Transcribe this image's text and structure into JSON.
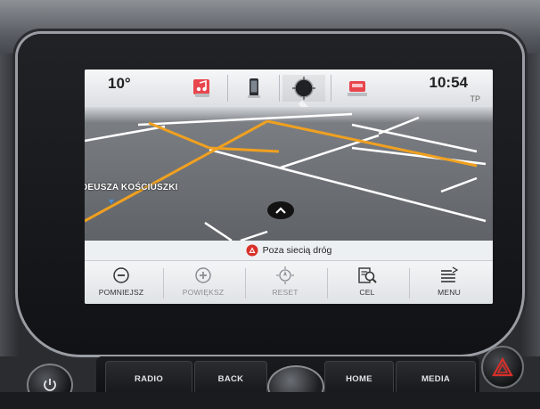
{
  "status": {
    "temperature": "10°",
    "time": "10:54",
    "tp_indicator": "TP"
  },
  "top_tabs": [
    {
      "name": "audio",
      "icon": "music-note-icon"
    },
    {
      "name": "phone",
      "icon": "phone-icon"
    },
    {
      "name": "navigation",
      "icon": "navigation-icon",
      "active": true
    },
    {
      "name": "onstar",
      "icon": "car-icon"
    }
  ],
  "map": {
    "street_label": "DEUSZA KOŚCIUSZKI",
    "status_message": "Poza siecią dróg",
    "colors": {
      "background": "#6b6f74",
      "road": "#ffffff",
      "main_road": "#f0a020",
      "warning": "#d8302a"
    }
  },
  "bottom_bar": {
    "zoom_out_label": "POMNIEJSZ",
    "zoom_in_label": "POWIĘKSZ",
    "reset_label": "RESET",
    "destination_label": "CEL",
    "menu_label": "MENU"
  },
  "hardware": {
    "radio_label": "RADIO",
    "back_label": "BACK",
    "home_label": "HOME",
    "media_label": "MEDIA"
  }
}
